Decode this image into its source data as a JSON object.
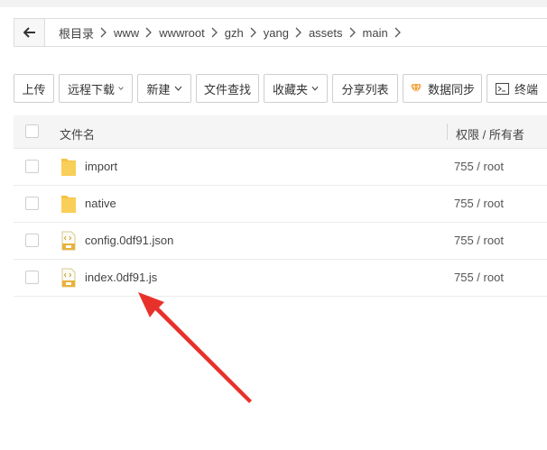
{
  "breadcrumb": {
    "items": [
      "根目录",
      "www",
      "wwwroot",
      "gzh",
      "yang",
      "assets",
      "main"
    ]
  },
  "toolbar": {
    "upload": "上传",
    "remote_download": "远程下载",
    "new": "新建",
    "file_search": "文件查找",
    "favorites": "收藏夹",
    "share_list": "分享列表",
    "data_sync": "数据同步",
    "terminal": "终端"
  },
  "table": {
    "header_name": "文件名",
    "header_perm": "权限 / 所有者",
    "rows": [
      {
        "name": "import",
        "perm": "755 / root",
        "type": "folder"
      },
      {
        "name": "native",
        "perm": "755 / root",
        "type": "folder"
      },
      {
        "name": "config.0df91.json",
        "perm": "755 / root",
        "type": "file"
      },
      {
        "name": "index.0df91.js",
        "perm": "755 / root",
        "type": "file"
      }
    ]
  },
  "colors": {
    "folder": "#f5c342",
    "file_badge": "#e8b23a",
    "arrow": "#e8312b",
    "data_sync_icon": "#f29b2c"
  },
  "icons": {
    "back": "back-arrow-icon",
    "separator": "chevron-right-icon",
    "caret": "chevron-down-icon",
    "folder": "folder-icon",
    "file": "code-file-icon",
    "data_sync": "diamond-icon",
    "terminal": "terminal-icon"
  }
}
